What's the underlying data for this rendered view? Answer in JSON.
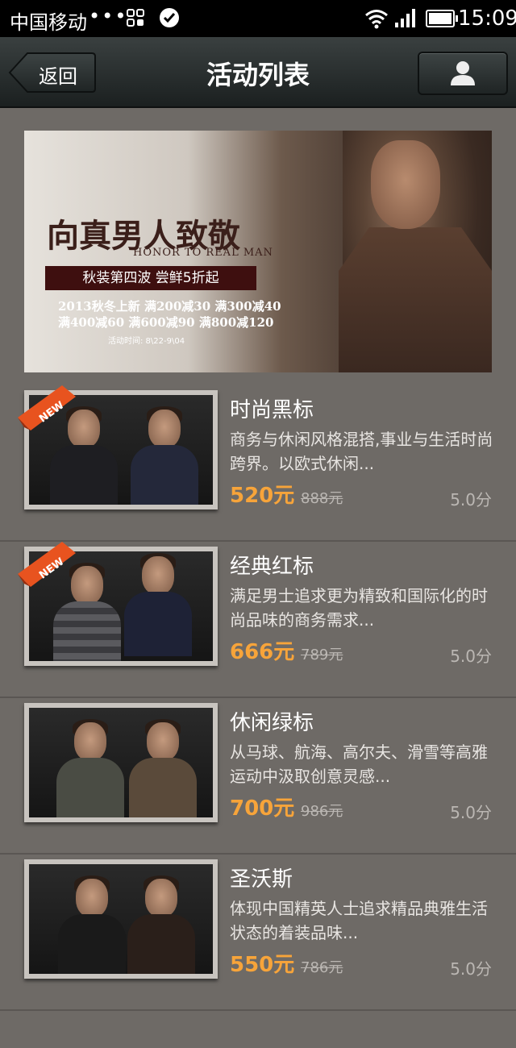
{
  "status_bar": {
    "carrier": "中国移动",
    "dots": "•••",
    "time": "15:09"
  },
  "nav": {
    "back_label": "返回",
    "title": "活动列表"
  },
  "banner": {
    "headline": "向真男人致敬",
    "subhead": "HONOR TO REAL MAN",
    "promo": "秋装第四波  尝鲜5折起",
    "deal_line1": "2013秋冬上新  满200减30  满300减40",
    "deal_line2": "满400减60  满600减90  满800减120",
    "dates": "活动时间:  8\\22-9\\04"
  },
  "items": [
    {
      "title": "时尚黑标",
      "desc": "商务与休闲风格混搭,事业与生活时尚跨界。以欧式休闲...",
      "price": "520元",
      "original_price": "888元",
      "rating": "5.0分",
      "badge": "NEW"
    },
    {
      "title": "经典红标",
      "desc": "满足男士追求更为精致和国际化的时尚品味的商务需求...",
      "price": "666元",
      "original_price": "789元",
      "rating": "5.0分",
      "badge": "NEW"
    },
    {
      "title": "休闲绿标",
      "desc": "从马球、航海、高尔夫、滑雪等高雅运动中汲取创意灵感...",
      "price": "700元",
      "original_price": "986元",
      "rating": "5.0分"
    },
    {
      "title": "圣沃斯",
      "desc": "体现中国精英人士追求精品典雅生活状态的着装品味...",
      "price": "550元",
      "original_price": "786元",
      "rating": "5.0分"
    }
  ],
  "colors": {
    "price": "#f7a43a",
    "background": "#6e6a66",
    "navbar": "#1b2020"
  }
}
